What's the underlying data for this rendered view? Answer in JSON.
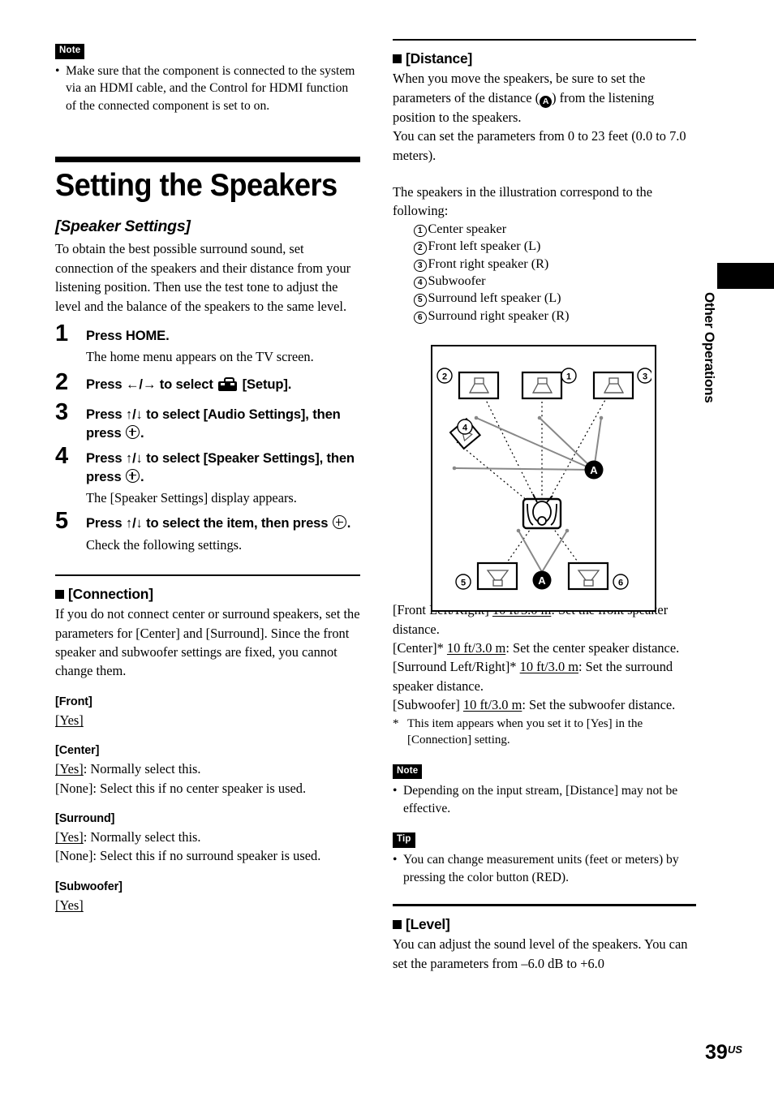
{
  "page": {
    "number": "39",
    "locale_suffix": "US",
    "margin_tab_label": "Other Operations"
  },
  "left_column": {
    "top_note": {
      "badge": "Note",
      "bullets": [
        "Make sure that the component is connected to the system via an HDMI cable, and the Control for HDMI function of the connected component is set to on."
      ]
    },
    "chapter_title": "Setting the Speakers",
    "subhead": "[Speaker Settings]",
    "intro": "To obtain the best possible surround sound, set connection of the speakers and their distance from your listening position. Then use the test tone to adjust the level and the balance of the speakers to the same level.",
    "steps": [
      {
        "number": "1",
        "title_before": "Press HOME.",
        "title_after": "",
        "icon": "",
        "desc": "The home menu appears on the TV screen."
      },
      {
        "number": "2",
        "title_before": "Press ←/→ to select",
        "title_after": "[Setup].",
        "icon": "toolbox-icon",
        "desc": ""
      },
      {
        "number": "3",
        "title_before": "Press ↑/↓ to select [Audio Settings], then press",
        "title_after": ".",
        "icon": "enter-icon",
        "desc": ""
      },
      {
        "number": "4",
        "title_before": "Press ↑/↓ to select [Speaker Settings], then press",
        "title_after": ".",
        "icon": "enter-icon",
        "desc": "The [Speaker Settings] display appears."
      },
      {
        "number": "5",
        "title_before": "Press ↑/↓ to select the item, then press",
        "title_after": ".",
        "icon": "enter-icon",
        "desc": "Check the following settings."
      }
    ],
    "connection": {
      "heading": "[Connection]",
      "body": "If you do not connect center or surround speakers, set the parameters for [Center] and [Surround]. Since the front speaker and subwoofer settings are fixed, you cannot change them.",
      "groups": [
        {
          "label": "[Front]",
          "options": [
            {
              "value": "[Yes]",
              "underlined": true,
              "desc": ""
            }
          ]
        },
        {
          "label": "[Center]",
          "options": [
            {
              "value": "[Yes]",
              "underlined": true,
              "desc": ": Normally select this."
            },
            {
              "value": "[None]",
              "underlined": false,
              "desc": ": Select this if no center speaker is used."
            }
          ]
        },
        {
          "label": "[Surround]",
          "options": [
            {
              "value": "[Yes]",
              "underlined": true,
              "desc": ": Normally select this."
            },
            {
              "value": "[None]",
              "underlined": false,
              "desc": ": Select this if no surround speaker is used."
            }
          ]
        },
        {
          "label": "[Subwoofer]",
          "options": [
            {
              "value": "[Yes]",
              "underlined": true,
              "desc": ""
            }
          ]
        }
      ]
    }
  },
  "right_column": {
    "distance": {
      "heading": "[Distance]",
      "para1_a": "When you move the speakers, be sure to set the parameters of the distance (",
      "para1_badge": "A",
      "para1_b": ") from the listening position to the speakers.",
      "para2": "You can set the parameters from 0 to 23 feet (0.0 to 7.0 meters).",
      "illustration_intro": "The speakers in the illustration correspond to the following:",
      "legend": [
        {
          "num": "1",
          "label": "Center speaker"
        },
        {
          "num": "2",
          "label": "Front left speaker (L)"
        },
        {
          "num": "3",
          "label": "Front right speaker (R)"
        },
        {
          "num": "4",
          "label": "Subwoofer"
        },
        {
          "num": "5",
          "label": "Surround left speaker (L)"
        },
        {
          "num": "6",
          "label": "Surround right speaker (R)"
        }
      ],
      "diagram": {
        "callouts": [
          "1",
          "2",
          "3",
          "4",
          "5",
          "6"
        ],
        "distance_markers": [
          "A",
          "A"
        ],
        "icons": [
          "front-speaker-icon",
          "center-speaker-icon",
          "subwoofer-icon",
          "surround-speaker-icon",
          "listener-seat-icon"
        ]
      },
      "settings": [
        {
          "label": "[Front Left/Right]",
          "value": "10 ft/3.0 m",
          "desc": ": Set the front speaker distance."
        },
        {
          "label": "[Center]*",
          "value": "10 ft/3.0 m",
          "desc": ": Set the center speaker distance."
        },
        {
          "label": "[Surround Left/Right]*",
          "value": "10 ft/3.0 m",
          "desc": ": Set the surround speaker distance."
        },
        {
          "label": "[Subwoofer]",
          "value": "10 ft/3.0 m",
          "desc": ": Set the subwoofer distance."
        }
      ],
      "footnote": "This item appears when you set it to [Yes] in the [Connection] setting.",
      "footnote_marker": "*",
      "note": {
        "badge": "Note",
        "bullets": [
          "Depending on the input stream, [Distance] may not be effective."
        ]
      },
      "tip": {
        "badge": "Tip",
        "bullets": [
          "You can change measurement units (feet or meters) by pressing the color button (RED)."
        ]
      }
    },
    "level": {
      "heading": "[Level]",
      "body": "You can adjust the sound level of the speakers. You can set the parameters from –6.0 dB to +6.0"
    }
  }
}
